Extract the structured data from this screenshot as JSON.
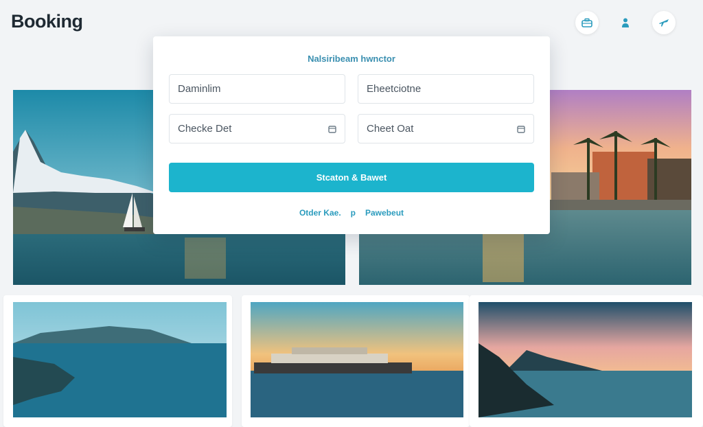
{
  "header": {
    "logo": "Booking",
    "icons": [
      "suitcase-icon",
      "user-icon",
      "plane-icon"
    ]
  },
  "booking_form": {
    "title": "Nalsiribeam hwnctor",
    "destination": "Daminlim",
    "guests": "Eheetciotne",
    "check_in": "Checke Det",
    "check_out": "Cheet Oat",
    "search_button": "Stcaton & Bawet",
    "link_left": "Otder Kae.",
    "separator": "p",
    "link_right": "Pawebeut"
  },
  "colors": {
    "accent": "#1cb4cd",
    "link": "#2a9bbd",
    "title": "#3a8fb0"
  }
}
